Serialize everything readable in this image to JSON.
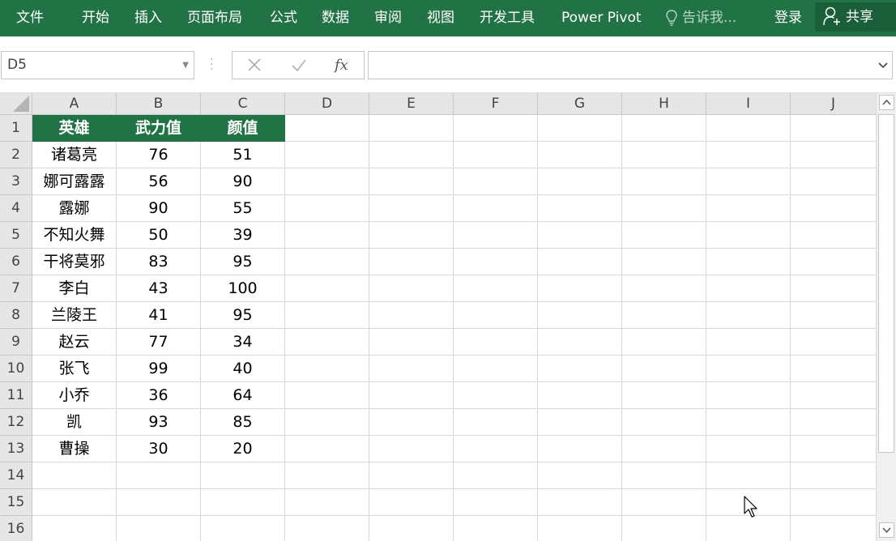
{
  "ribbon": {
    "tabs": [
      "文件",
      "开始",
      "插入",
      "页面布局",
      "公式",
      "数据",
      "审阅",
      "视图",
      "开发工具",
      "Power Pivot"
    ],
    "tell_me": "告诉我...",
    "login": "登录",
    "share": "共享",
    "colors": {
      "background": "#217346",
      "text": "#ffffff"
    }
  },
  "formula_bar": {
    "name_box": "D5",
    "cancel_icon": "x-icon",
    "enter_icon": "check-icon",
    "function_label": "fx",
    "formula_value": ""
  },
  "sheet": {
    "columns": [
      "A",
      "B",
      "C",
      "D",
      "E",
      "F",
      "G",
      "H",
      "I",
      "J"
    ],
    "rows": [
      "1",
      "2",
      "3",
      "4",
      "5",
      "6",
      "7",
      "8",
      "9",
      "10",
      "11",
      "12",
      "13",
      "14",
      "15",
      "16"
    ],
    "header": [
      "英雄",
      "武力值",
      "颜值"
    ],
    "data": [
      [
        "诸葛亮",
        "76",
        "51"
      ],
      [
        "娜可露露",
        "56",
        "90"
      ],
      [
        "露娜",
        "90",
        "55"
      ],
      [
        "不知火舞",
        "50",
        "39"
      ],
      [
        "干将莫邪",
        "83",
        "95"
      ],
      [
        "李白",
        "43",
        "100"
      ],
      [
        "兰陵王",
        "41",
        "95"
      ],
      [
        "赵云",
        "77",
        "34"
      ],
      [
        "张飞",
        "99",
        "40"
      ],
      [
        "小乔",
        "36",
        "64"
      ],
      [
        "凯",
        "93",
        "85"
      ],
      [
        "曹操",
        "30",
        "20"
      ]
    ],
    "header_fill": "#217346"
  }
}
